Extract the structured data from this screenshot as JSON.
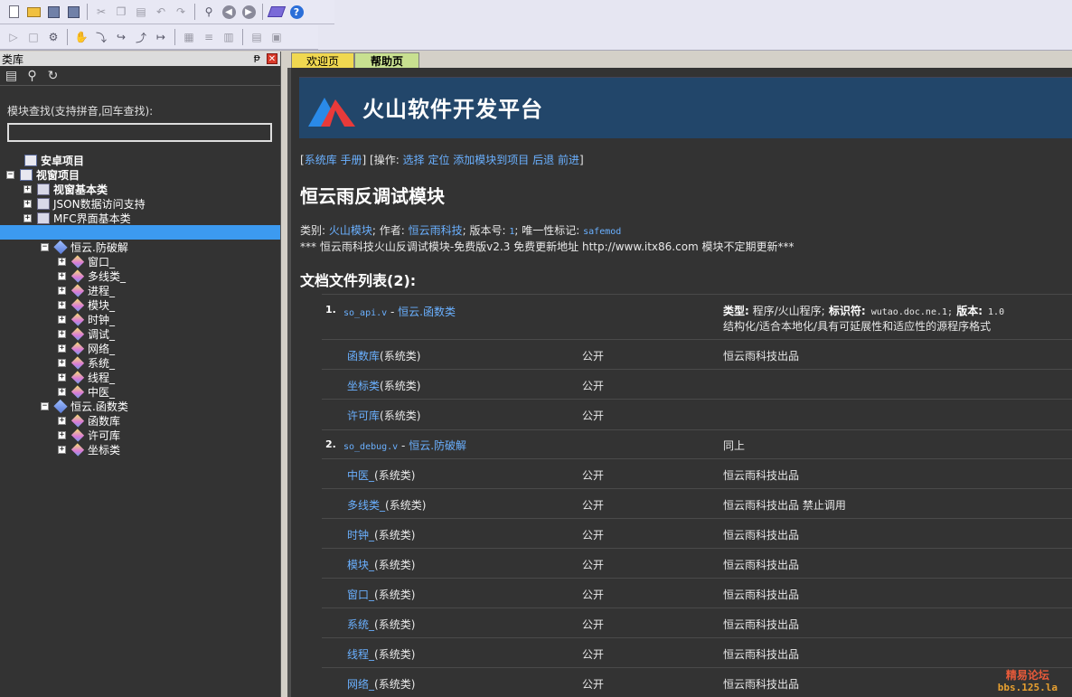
{
  "window": {
    "title": ""
  },
  "panel": {
    "title": "类库",
    "pin_glyph": "ᵽ",
    "close_glyph": "✕"
  },
  "search": {
    "label": "模块查找(支持拼音,回车查找):",
    "value": ""
  },
  "tree": {
    "android": "安卓项目",
    "windows": "视窗项目",
    "win_basic": "视窗基本类",
    "json": "JSON数据访问支持",
    "mfc": "MFC界面基本类",
    "anti_crack": "恒云.防破解",
    "anti_items": [
      "窗口_",
      "多线类_",
      "进程_",
      "模块_",
      "时钟_",
      "调试_",
      "网络_",
      "系统_",
      "线程_",
      "中医_"
    ],
    "func_class": "恒云.函数类",
    "func_items": [
      "函数库",
      "许可库",
      "坐标类"
    ]
  },
  "tabs": {
    "welcome": "欢迎页",
    "help": "帮助页"
  },
  "banner": {
    "title": "火山软件开发平台"
  },
  "ops": {
    "open": "[",
    "syslib": "系统库",
    "manual": "手册",
    "ops_label": "] [操作:",
    "select": "选择",
    "locate": "定位",
    "add": "添加模块到项目",
    "back": "后退",
    "forward": "前进",
    "close": "]"
  },
  "module": {
    "title": "恒云雨反调试模块",
    "cat_label": "类别:",
    "cat": "火山模块",
    "author_label": "; 作者:",
    "author": "恒云雨科技",
    "ver_label": "; 版本号:",
    "ver": "1",
    "uid_label": "; 唯一性标记:",
    "uid": "safemod",
    "desc": "*** 恒云雨科技火山反调试模块-免费版v2.3 免费更新地址 http://www.itx86.com 模块不定期更新***"
  },
  "files": {
    "heading": "文档文件列表(2):",
    "f1": {
      "num": "1.",
      "file": "so_api.v",
      "dash": " - ",
      "name": "恒云.函数类",
      "type_label": "类型:",
      "type": " 程序/火山程序;",
      "id_label": " 标识符:",
      "id": " wutao.doc.ne.1;",
      "ver_label": " 版本:",
      "ver": " 1.0",
      "desc": "结构化/适合本地化/具有可延展性和适应性的源程序格式",
      "rows": [
        {
          "name": "函数库",
          "kind": "(系统类)",
          "access": "公开",
          "note": "恒云雨科技出品"
        },
        {
          "name": "坐标类",
          "kind": "(系统类)",
          "access": "公开",
          "note": ""
        },
        {
          "name": "许可库",
          "kind": "(系统类)",
          "access": "公开",
          "note": ""
        }
      ]
    },
    "f2": {
      "num": "2.",
      "file": "so_debug.v",
      "dash": " - ",
      "name": "恒云.防破解",
      "note": "同上",
      "rows": [
        {
          "name": "中医_",
          "kind": "(系统类)",
          "access": "公开",
          "note": "恒云雨科技出品"
        },
        {
          "name": "多线类_",
          "kind": "(系统类)",
          "access": "公开",
          "note": "恒云雨科技出品 禁止调用"
        },
        {
          "name": "时钟_",
          "kind": "(系统类)",
          "access": "公开",
          "note": "恒云雨科技出品"
        },
        {
          "name": "模块_",
          "kind": "(系统类)",
          "access": "公开",
          "note": "恒云雨科技出品"
        },
        {
          "name": "窗口_",
          "kind": "(系统类)",
          "access": "公开",
          "note": "恒云雨科技出品"
        },
        {
          "name": "系统_",
          "kind": "(系统类)",
          "access": "公开",
          "note": "恒云雨科技出品"
        },
        {
          "name": "线程_",
          "kind": "(系统类)",
          "access": "公开",
          "note": "恒云雨科技出品"
        },
        {
          "name": "网络_",
          "kind": "(系统类)",
          "access": "公开",
          "note": "恒云雨科技出品"
        }
      ]
    }
  },
  "watermark": {
    "line1": "精易论坛",
    "line2": "bbs.125.la"
  }
}
